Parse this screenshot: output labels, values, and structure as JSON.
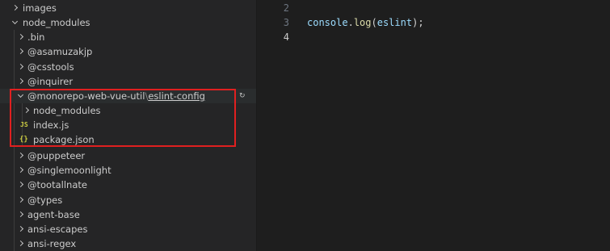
{
  "explorer": {
    "items": [
      {
        "label": "images"
      },
      {
        "label": "node_modules"
      },
      {
        "label": ".bin"
      },
      {
        "label": "@asamuzakjp"
      },
      {
        "label": "@csstools"
      },
      {
        "label": "@inquirer"
      },
      {
        "label_main": "@monorepo-web-vue-util",
        "label_sep": "\\",
        "label_sub": "eslint-config"
      },
      {
        "label": "node_modules"
      },
      {
        "icon_text": "JS",
        "label": "index.js"
      },
      {
        "icon_text": "{}",
        "label": "package.json"
      },
      {
        "label": "@puppeteer"
      },
      {
        "label": "@singlemoonlight"
      },
      {
        "label": "@tootallnate"
      },
      {
        "label": "@types"
      },
      {
        "label": "agent-base"
      },
      {
        "label": "ansi-escapes"
      },
      {
        "label": "ansi-regex"
      }
    ]
  },
  "editor": {
    "lines": [
      {
        "number": "2",
        "text": ""
      },
      {
        "number": "3",
        "obj": "console",
        "dot": ".",
        "fn": "log",
        "open": "(",
        "arg": "eslint",
        "close": ");"
      },
      {
        "number": "4",
        "text": ""
      }
    ]
  },
  "colors": {
    "highlight_box": "#e02020",
    "sidebar_bg": "#252526",
    "editor_bg": "#1e1e1e"
  }
}
